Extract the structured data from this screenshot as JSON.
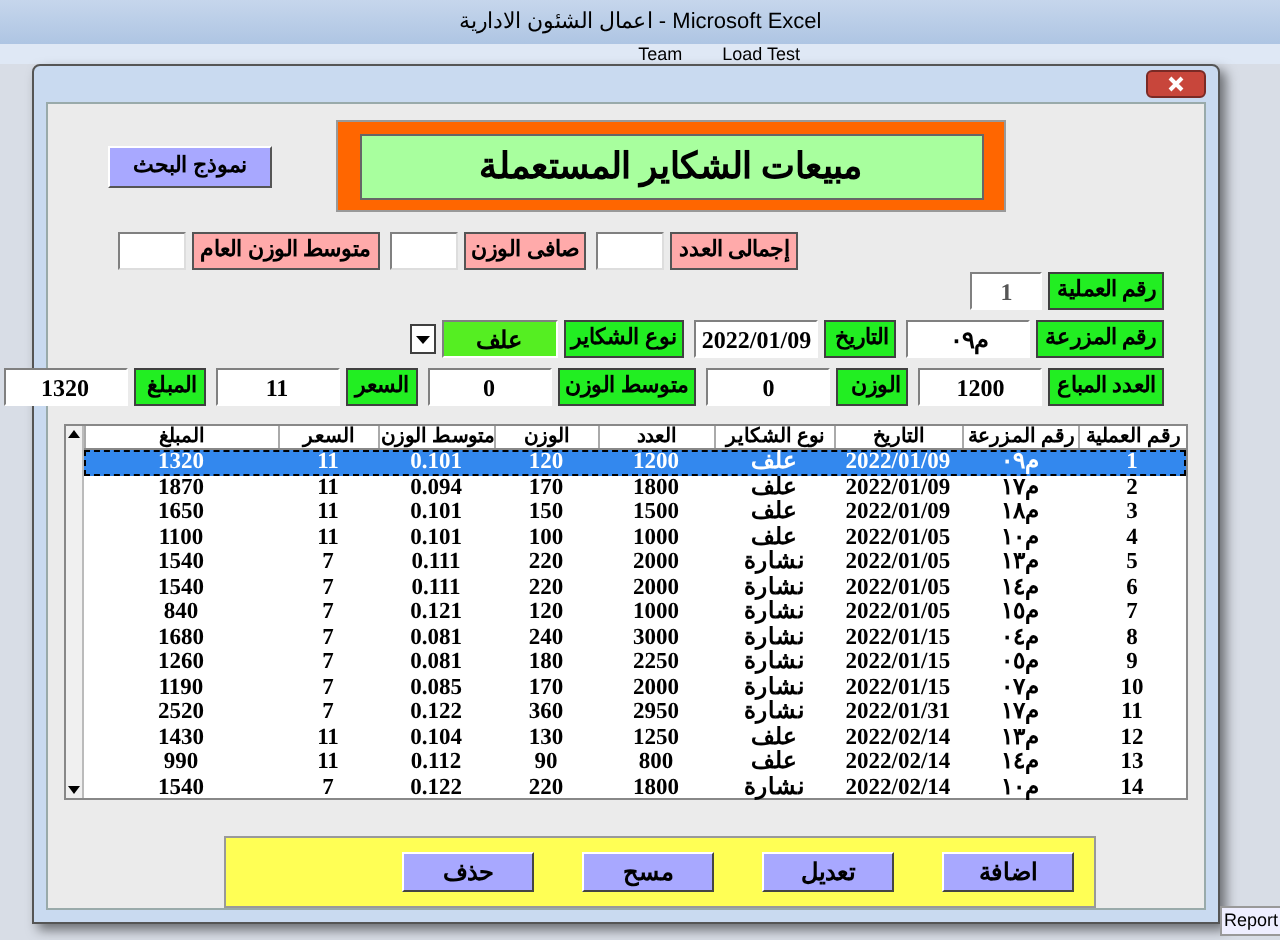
{
  "app_window": {
    "title": "اعمال الشئون الادارية - Microsoft Excel",
    "ribbon_tabs": [
      "Load Test",
      "Team"
    ],
    "sheet_tabs": [
      "Report"
    ]
  },
  "dialog": {
    "search_button": "نموذج البحث",
    "title": "مبيعات الشكاير المستعملة",
    "totals": [
      {
        "label": "إجمالى العدد"
      },
      {
        "label": "صافى الوزن"
      },
      {
        "label": "متوسط الوزن العام"
      }
    ],
    "form_rows": [
      [
        {
          "label": "رقم العملية",
          "value": "1",
          "kind": "readonly"
        }
      ],
      [
        {
          "label": "رقم المزرعة",
          "value": "م٠٩",
          "kind": "text"
        },
        {
          "label": "التاريخ",
          "value": "2022/01/09",
          "kind": "text"
        },
        {
          "label": "نوع الشكاير",
          "value": "علف",
          "kind": "combo"
        }
      ],
      [
        {
          "label": "العدد المباع",
          "value": "1200",
          "kind": "text"
        },
        {
          "label": "الوزن",
          "value": "0",
          "kind": "text"
        },
        {
          "label": "متوسط الوزن",
          "value": "0",
          "kind": "text"
        },
        {
          "label": "السعر",
          "value": "11",
          "kind": "text"
        },
        {
          "label": "المبلغ",
          "value": "1320",
          "kind": "text"
        }
      ]
    ],
    "table": {
      "columns": [
        "رقم العملية",
        "رقم المزرعة",
        "التاريخ",
        "نوع الشكاير",
        "العدد",
        "الوزن",
        "متوسط الوزن",
        "السعر",
        "المبلغ"
      ],
      "rows": [
        {
          "cells": [
            "1",
            "م٠٩",
            "2022/01/09",
            "علف",
            "1200",
            "120",
            "0.101",
            "11",
            "1320"
          ],
          "selected": true
        },
        {
          "cells": [
            "2",
            "م١٧",
            "2022/01/09",
            "علف",
            "1800",
            "170",
            "0.094",
            "11",
            "1870"
          ],
          "selected": false
        },
        {
          "cells": [
            "3",
            "م١٨",
            "2022/01/09",
            "علف",
            "1500",
            "150",
            "0.101",
            "11",
            "1650"
          ],
          "selected": false
        },
        {
          "cells": [
            "4",
            "م١٠",
            "2022/01/05",
            "علف",
            "1000",
            "100",
            "0.101",
            "11",
            "1100"
          ],
          "selected": false
        },
        {
          "cells": [
            "5",
            "م١٣",
            "2022/01/05",
            "نشارة",
            "2000",
            "220",
            "0.111",
            "7",
            "1540"
          ],
          "selected": false
        },
        {
          "cells": [
            "6",
            "م١٤",
            "2022/01/05",
            "نشارة",
            "2000",
            "220",
            "0.111",
            "7",
            "1540"
          ],
          "selected": false
        },
        {
          "cells": [
            "7",
            "م١٥",
            "2022/01/05",
            "نشارة",
            "1000",
            "120",
            "0.121",
            "7",
            "840"
          ],
          "selected": false
        },
        {
          "cells": [
            "8",
            "م٠٤",
            "2022/01/15",
            "نشارة",
            "3000",
            "240",
            "0.081",
            "7",
            "1680"
          ],
          "selected": false
        },
        {
          "cells": [
            "9",
            "م٠٥",
            "2022/01/15",
            "نشارة",
            "2250",
            "180",
            "0.081",
            "7",
            "1260"
          ],
          "selected": false
        },
        {
          "cells": [
            "10",
            "م٠٧",
            "2022/01/15",
            "نشارة",
            "2000",
            "170",
            "0.085",
            "7",
            "1190"
          ],
          "selected": false
        },
        {
          "cells": [
            "11",
            "م١٧",
            "2022/01/31",
            "نشارة",
            "2950",
            "360",
            "0.122",
            "7",
            "2520"
          ],
          "selected": false
        },
        {
          "cells": [
            "12",
            "م١٣",
            "2022/02/14",
            "علف",
            "1250",
            "130",
            "0.104",
            "11",
            "1430"
          ],
          "selected": false
        },
        {
          "cells": [
            "13",
            "م١٤",
            "2022/02/14",
            "علف",
            "800",
            "90",
            "0.112",
            "11",
            "990"
          ],
          "selected": false
        },
        {
          "cells": [
            "14",
            "م١٠",
            "2022/02/14",
            "نشارة",
            "1800",
            "220",
            "0.122",
            "7",
            "1540"
          ],
          "selected": false
        }
      ]
    },
    "actions": [
      "اضافة",
      "تعديل",
      "مسح",
      "حذف"
    ]
  }
}
